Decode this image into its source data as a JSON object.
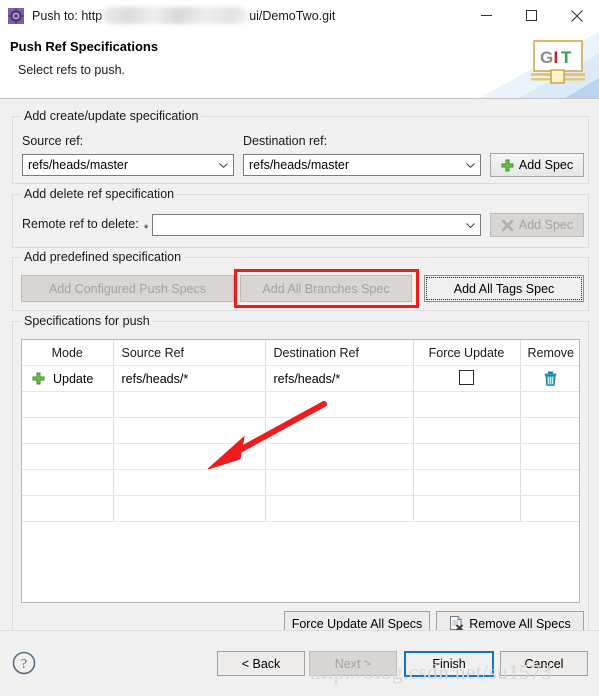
{
  "window": {
    "title_prefix": "Push to: http",
    "title_suffix": "ui/DemoTwo.git",
    "icon": "gear-icon",
    "minimize_label": "─",
    "maximize_label": "□",
    "close_label": "✕"
  },
  "header": {
    "title": "Push Ref Specifications",
    "subtitle": "Select refs to push.",
    "logo_g": "G",
    "logo_i": "I",
    "logo_t": "T"
  },
  "create_update_group": {
    "legend": "Add create/update specification",
    "source_label": "Source ref:",
    "source_value": "refs/heads/master",
    "destination_label": "Destination ref:",
    "destination_value": "refs/heads/master",
    "add_spec_label": "Add Spec"
  },
  "delete_group": {
    "legend": "Add delete ref specification",
    "remote_label": "Remote ref to delete:",
    "remote_value": "",
    "remote_required_marker": "*",
    "add_spec_label": "Add Spec"
  },
  "predefined_group": {
    "legend": "Add predefined specification",
    "add_configured_label": "Add Configured Push Specs",
    "add_all_branches_label": "Add All Branches Spec",
    "add_all_tags_label": "Add All Tags Spec"
  },
  "specs_group": {
    "legend": "Specifications for push",
    "columns": [
      "Mode",
      "Source Ref",
      "Destination Ref",
      "Force Update",
      "Remove"
    ],
    "rows": [
      {
        "mode": "Update",
        "mode_icon": "green-plus-icon",
        "source_ref": "refs/heads/*",
        "destination_ref": "refs/heads/*",
        "force_update_checked": false,
        "remove_icon": "trash-icon"
      }
    ],
    "empty_row_count": 5,
    "force_update_all_label": "Force Update All Specs",
    "remove_all_label": "Remove All Specs"
  },
  "footer": {
    "help_label": "?",
    "back_label": "< Back",
    "next_label": "Next >",
    "finish_label": "Finish",
    "cancel_label": "Cancel"
  },
  "annotations": {
    "watermark": "http://blog.csdn.net/su1573",
    "highlight_target": "Add All Branches Spec",
    "highlight_color": "#ee1c1c"
  }
}
